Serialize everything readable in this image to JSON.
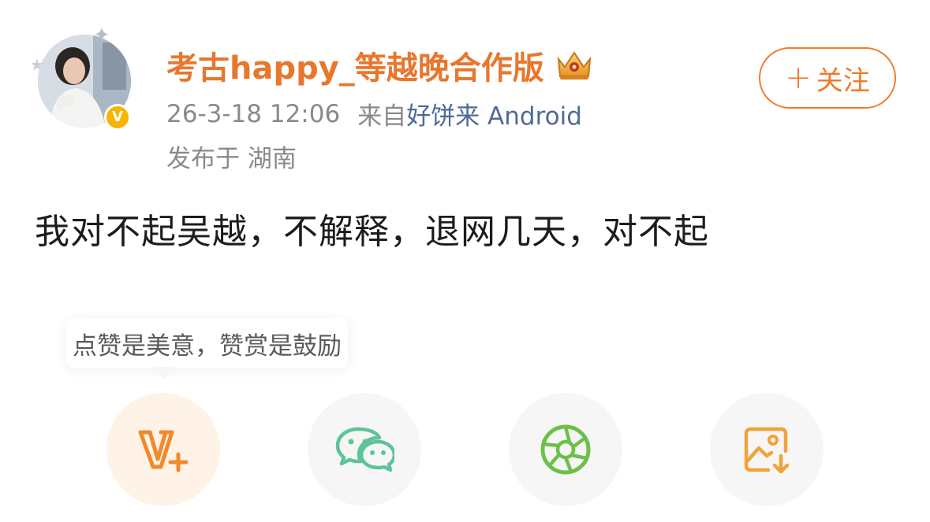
{
  "post": {
    "author": {
      "username": "考古happy_等越晚合作版",
      "verified_badge": "V",
      "name_color": "#e8772e"
    },
    "meta": {
      "timestamp": "26-3-18 12:06",
      "source_label": "来自",
      "source_app": "好饼来 Android",
      "location": "发布于 湖南"
    },
    "follow_button": {
      "label": "关注",
      "icon": "plus-icon",
      "color": "#f07b2a"
    },
    "content": "我对不起吴越，不解释，退网几天，对不起"
  },
  "tooltip": {
    "text": "点赞是美意，赞赏是鼓励"
  },
  "share_actions": [
    {
      "name": "reward",
      "icon": "reward-v-plus-icon",
      "color": "#f08a2c"
    },
    {
      "name": "wechat",
      "icon": "wechat-icon",
      "color": "#5cc498"
    },
    {
      "name": "moments",
      "icon": "moments-aperture-icon",
      "color": "#6cc04a"
    },
    {
      "name": "save-image",
      "icon": "save-image-icon",
      "color": "#f2a23a"
    }
  ]
}
